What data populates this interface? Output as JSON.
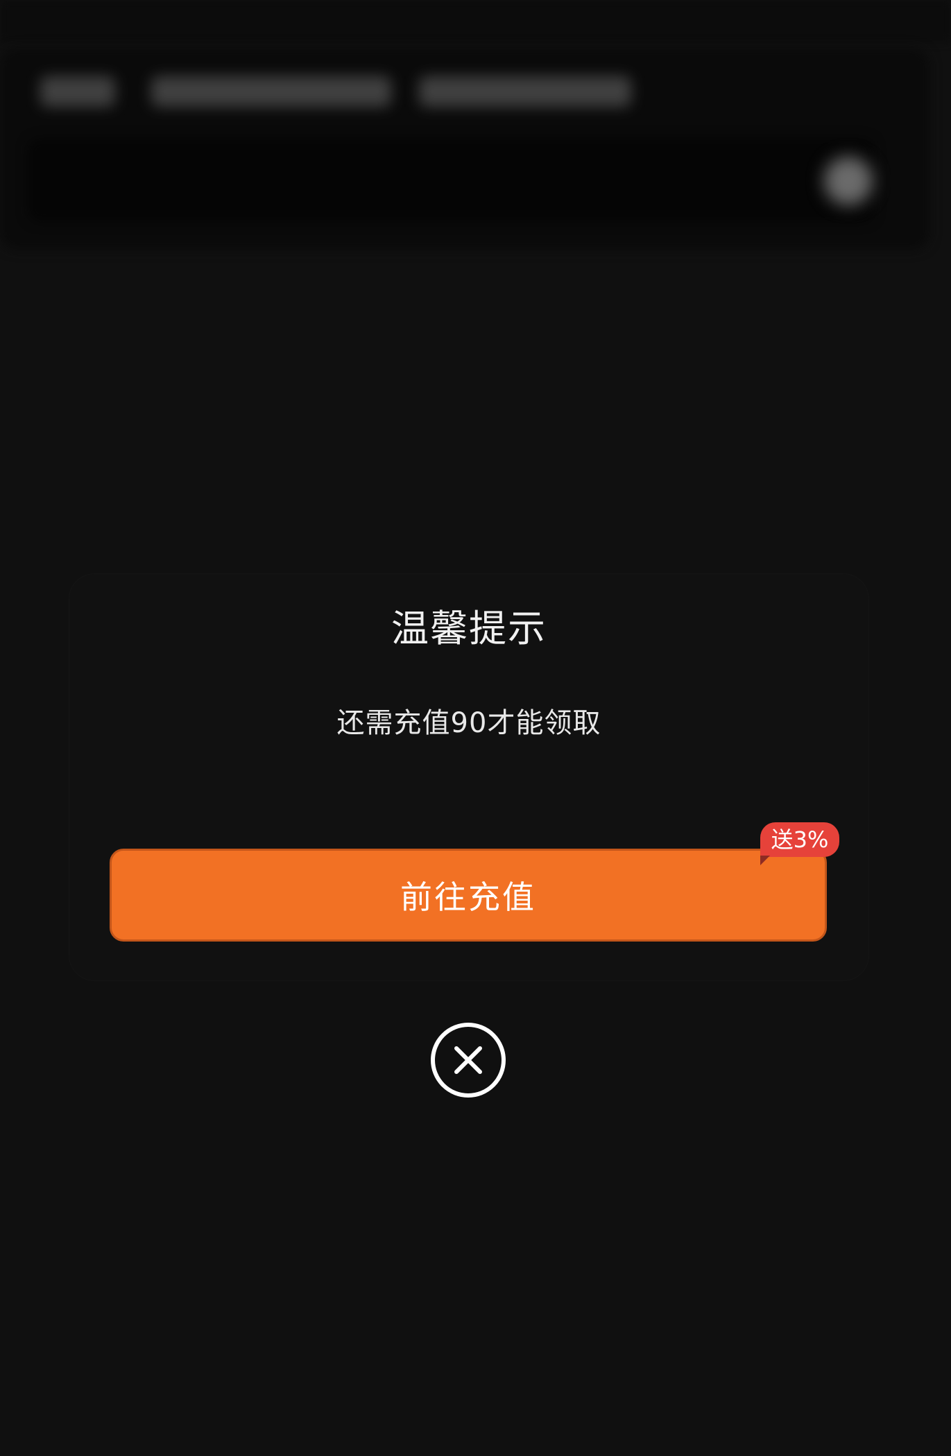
{
  "dialog": {
    "title": "温馨提示",
    "message": "还需充值90才能领取",
    "primary_button_label": "前往充值",
    "promo_badge": "送3%"
  },
  "icons": {
    "close": "close-circle-icon"
  },
  "colors": {
    "background": "#101010",
    "dialog_bg": "#111111",
    "button": "#f27124",
    "button_border": "#c4561a",
    "badge": "#e6423a",
    "text": "#f1f1f1"
  }
}
